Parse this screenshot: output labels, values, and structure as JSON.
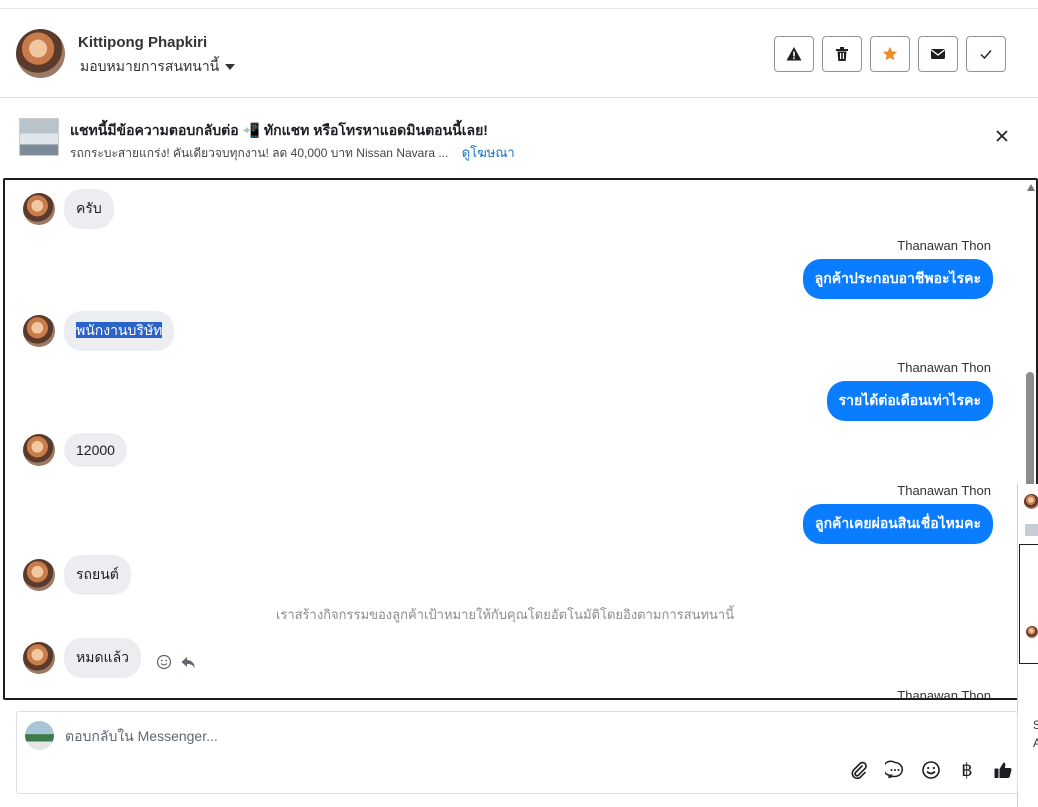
{
  "header": {
    "contact_name": "Kittipong Phapkiri",
    "assign_label": "มอบหมายการสนทนานี้",
    "actions": [
      "report",
      "delete",
      "star",
      "mark-unread",
      "done"
    ],
    "star_color": "#f28c28"
  },
  "ad": {
    "title": "แชทนี้มีข้อความตอบกลับต่อ 📲 ทักแชท หรือโทรหาแอดมินตอนนี้เลย!",
    "subtitle": "รถกระบะสายแกร่ง! คันเดียวจบทุกงาน! ลด 40,000 บาท Nissan Navara ...",
    "link": "ดูโฆษณา"
  },
  "thread": {
    "messages": [
      {
        "direction": "in",
        "text": "ครับ"
      },
      {
        "direction": "out",
        "sender": "Thanawan Thon",
        "text": "ลูกค้าประกอบอาชีพอะไรคะ"
      },
      {
        "direction": "in",
        "text": "พนักงานบริษัท",
        "highlighted": true
      },
      {
        "direction": "out",
        "sender": "Thanawan Thon",
        "text": "รายได้ต่อเดือนเท่าไรคะ"
      },
      {
        "direction": "in",
        "text": "12000"
      },
      {
        "direction": "out",
        "sender": "Thanawan Thon",
        "text": "ลูกค้าเคยผ่อนสินเชื่อไหมคะ"
      },
      {
        "direction": "in",
        "text": "รถยนต์"
      },
      {
        "direction": "system",
        "text": "เราสร้างกิจกรรมของลูกค้าเป้าหมายให้กับคุณโดยอัตโนมัติโดยอิงตามการสนทนานี้"
      },
      {
        "direction": "in",
        "text": "หมดแล้ว"
      },
      {
        "direction": "out",
        "sender": "Thanawan Thon",
        "text": ""
      }
    ],
    "accent_color": "#0a7cff"
  },
  "peek": {
    "letters": [
      "S",
      "A"
    ]
  },
  "composer": {
    "placeholder": "ตอบกลับใน Messenger...",
    "value": "",
    "tools": [
      "attach",
      "saved-reply",
      "emoji",
      "baht",
      "like"
    ],
    "currency_symbol": "฿"
  }
}
